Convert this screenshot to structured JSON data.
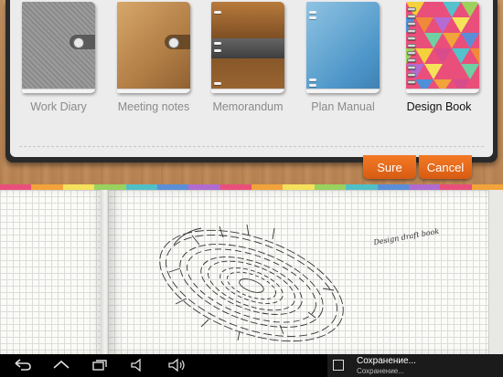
{
  "picker": {
    "books": [
      {
        "label": "Work Diary",
        "selected": false,
        "cover": "gray-fabric"
      },
      {
        "label": "Meeting notes",
        "selected": false,
        "cover": "tan-leather"
      },
      {
        "label": "Memorandum",
        "selected": false,
        "cover": "brown-leather-band"
      },
      {
        "label": "Plan Manual",
        "selected": false,
        "cover": "blue"
      },
      {
        "label": "Design Book",
        "selected": true,
        "cover": "colorful-mosaic-spiral"
      }
    ]
  },
  "actions": {
    "sure_label": "Sure",
    "cancel_label": "Cancel"
  },
  "notebook": {
    "handwritten_note": "Design draft book"
  },
  "navbar": {
    "icons": [
      "back-icon",
      "home-icon",
      "recent-apps-icon",
      "volume-down-icon",
      "volume-up-icon"
    ]
  },
  "notification": {
    "title": "Сохранение...",
    "subtitle": "Сохранение..."
  },
  "colors": {
    "accent_orange": "#e8661a",
    "panel_dark": "#2a2a2a",
    "tabs": [
      "#e94f7a",
      "#f2a33a",
      "#f5e25a",
      "#9ad25f",
      "#4fc0c8",
      "#5a8fd8",
      "#b06ad0",
      "#e94f7a",
      "#f2a33a",
      "#f5e25a",
      "#9ad25f",
      "#4fc0c8",
      "#5a8fd8",
      "#b06ad0",
      "#e94f7a",
      "#f2a33a"
    ]
  }
}
